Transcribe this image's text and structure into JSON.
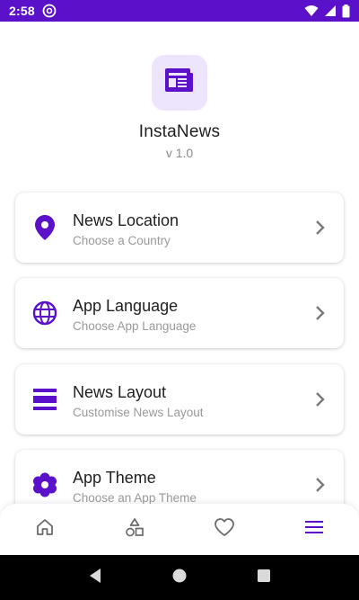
{
  "status_bar": {
    "time": "2:58",
    "background": "#5a11c9"
  },
  "app": {
    "name": "InstaNews",
    "version": "v 1.0",
    "logo_icon": "newspaper-icon",
    "accent": "#5a11c9"
  },
  "settings": [
    {
      "title": "News Location",
      "subtitle": "Choose a Country",
      "icon": "location-pin-icon"
    },
    {
      "title": "App Language",
      "subtitle": "Choose App Language",
      "icon": "globe-icon"
    },
    {
      "title": "News Layout",
      "subtitle": "Customise News Layout",
      "icon": "layout-icon"
    },
    {
      "title": "App Theme",
      "subtitle": "Choose an App Theme",
      "icon": "flower-icon"
    }
  ],
  "bottom_nav": {
    "items": [
      {
        "icon": "home-icon",
        "active": false
      },
      {
        "icon": "categories-icon",
        "active": false
      },
      {
        "icon": "heart-icon",
        "active": false
      },
      {
        "icon": "menu-icon",
        "active": true
      }
    ]
  },
  "system_nav": {
    "items": [
      "back-icon",
      "home-circle-icon",
      "recents-icon"
    ]
  }
}
